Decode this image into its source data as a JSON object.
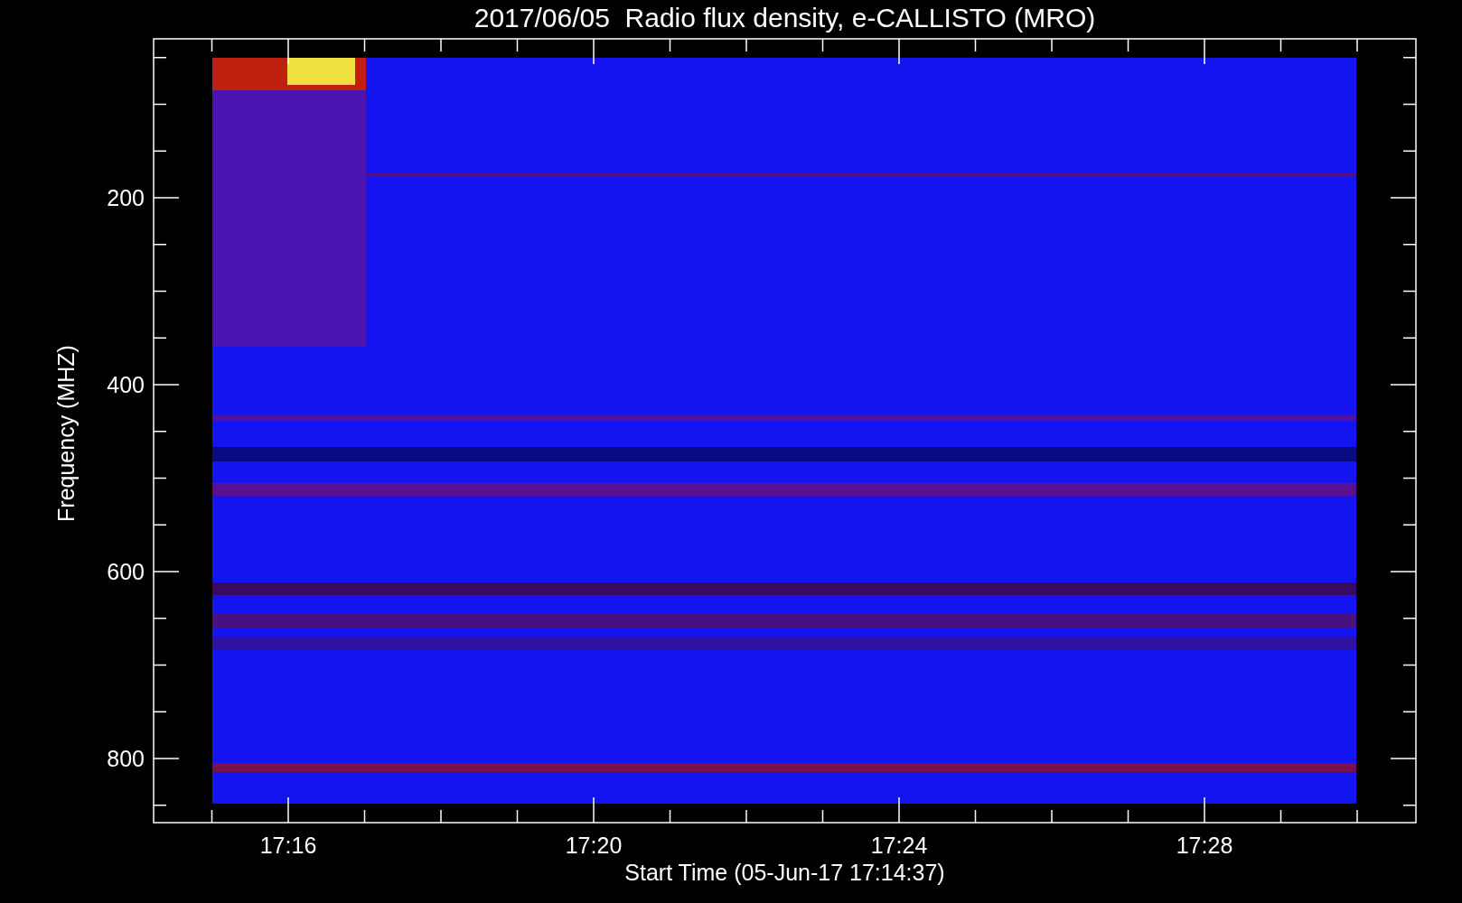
{
  "title": "2017/06/05  Radio flux density, e-CALLISTO (MRO)",
  "plot": {
    "ylabel": "Frequency (MHZ)",
    "xlabel": "Start Time (05-Jun-17 17:14:37)",
    "y_ticks": [
      "200",
      "400",
      "600",
      "800"
    ],
    "x_ticks": [
      "17:16",
      "17:20",
      "17:24",
      "17:28"
    ]
  }
}
